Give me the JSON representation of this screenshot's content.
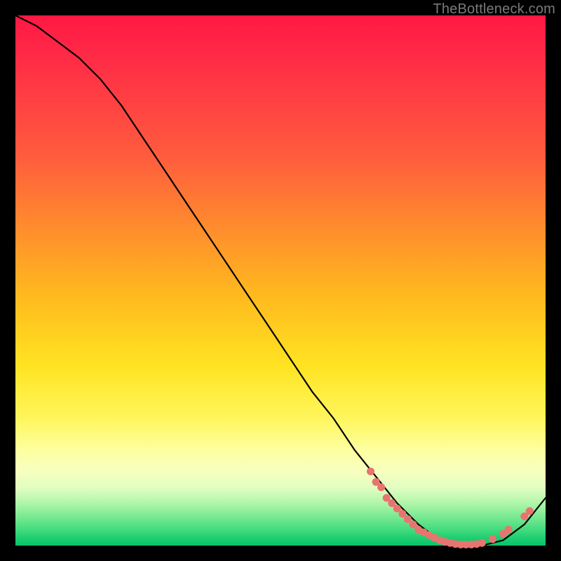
{
  "watermark": "TheBottleneck.com",
  "chart_data": {
    "type": "line",
    "title": "",
    "xlabel": "",
    "ylabel": "",
    "xlim": [
      0,
      100
    ],
    "ylim": [
      0,
      100
    ],
    "series": [
      {
        "name": "curve",
        "x": [
          0,
          4,
          8,
          12,
          16,
          20,
          24,
          28,
          32,
          36,
          40,
          44,
          48,
          52,
          56,
          60,
          64,
          68,
          72,
          76,
          80,
          84,
          88,
          92,
          96,
          100
        ],
        "y": [
          100,
          98,
          95,
          92,
          88,
          83,
          77,
          71,
          65,
          59,
          53,
          47,
          41,
          35,
          29,
          24,
          18,
          13,
          8,
          4,
          1,
          0,
          0,
          1,
          4,
          9
        ]
      }
    ],
    "markers": [
      {
        "x": 67,
        "y": 14
      },
      {
        "x": 68,
        "y": 12
      },
      {
        "x": 69,
        "y": 11
      },
      {
        "x": 70,
        "y": 9
      },
      {
        "x": 71,
        "y": 8
      },
      {
        "x": 72,
        "y": 7
      },
      {
        "x": 73,
        "y": 6
      },
      {
        "x": 74,
        "y": 5
      },
      {
        "x": 75,
        "y": 4
      },
      {
        "x": 76,
        "y": 3
      },
      {
        "x": 77,
        "y": 2.5
      },
      {
        "x": 78,
        "y": 2
      },
      {
        "x": 79,
        "y": 1.5
      },
      {
        "x": 80,
        "y": 1
      },
      {
        "x": 81,
        "y": 0.7
      },
      {
        "x": 82,
        "y": 0.5
      },
      {
        "x": 83,
        "y": 0.3
      },
      {
        "x": 84,
        "y": 0.2
      },
      {
        "x": 85,
        "y": 0.2
      },
      {
        "x": 86,
        "y": 0.2
      },
      {
        "x": 87,
        "y": 0.3
      },
      {
        "x": 88,
        "y": 0.5
      },
      {
        "x": 90,
        "y": 1.2
      },
      {
        "x": 92,
        "y": 2.2
      },
      {
        "x": 93,
        "y": 3.0
      },
      {
        "x": 96,
        "y": 5.5
      },
      {
        "x": 97,
        "y": 6.5
      }
    ],
    "marker_color": "#e8746f",
    "line_color": "#000000"
  }
}
